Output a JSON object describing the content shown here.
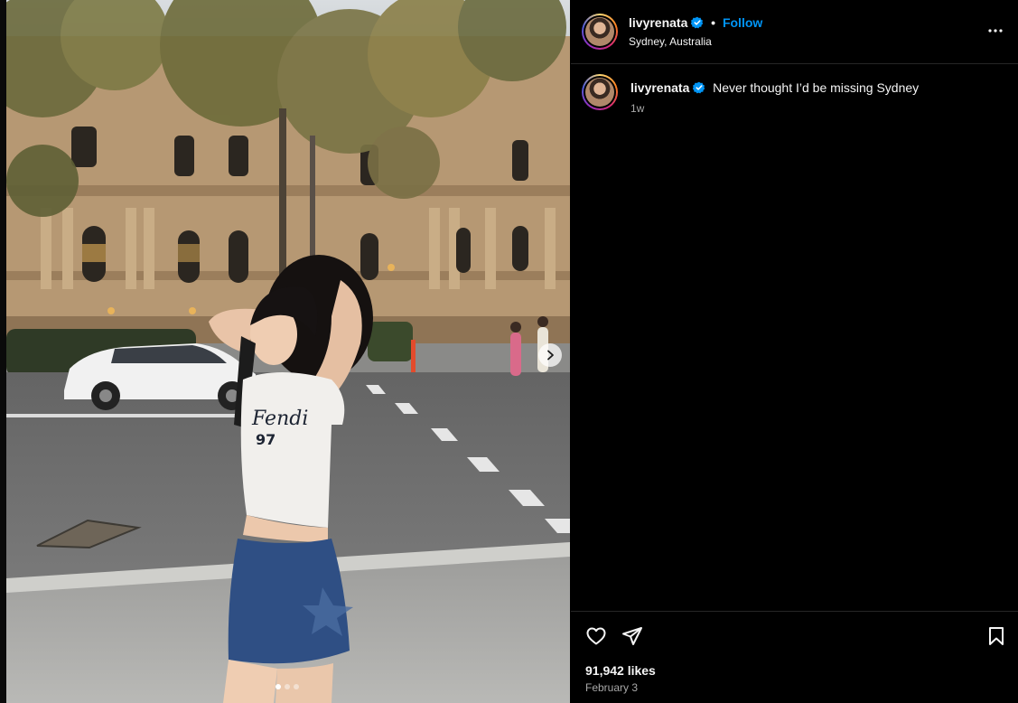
{
  "post": {
    "author": {
      "username": "livyrenata",
      "verified": true,
      "follow_label": "Follow",
      "separator": "•",
      "location": "Sydney, Australia"
    },
    "caption": {
      "username": "livyrenata",
      "text": "Never thought I’d be missing Sydney",
      "relative_time": "1w"
    },
    "media": {
      "carousel_total": 3,
      "carousel_index": 1,
      "shirt_text": "97"
    },
    "engagement": {
      "likes": "91,942 likes",
      "date": "February 3"
    }
  },
  "colors": {
    "background": "#000000",
    "accent_blue": "#0095f6",
    "muted_text": "#a8a8a8",
    "divider": "#262626"
  },
  "icons": {
    "more": "more-horizontal-icon",
    "like": "heart-icon",
    "share": "paper-plane-icon",
    "save": "bookmark-icon",
    "verified": "verified-badge-icon",
    "next": "chevron-right-icon"
  }
}
